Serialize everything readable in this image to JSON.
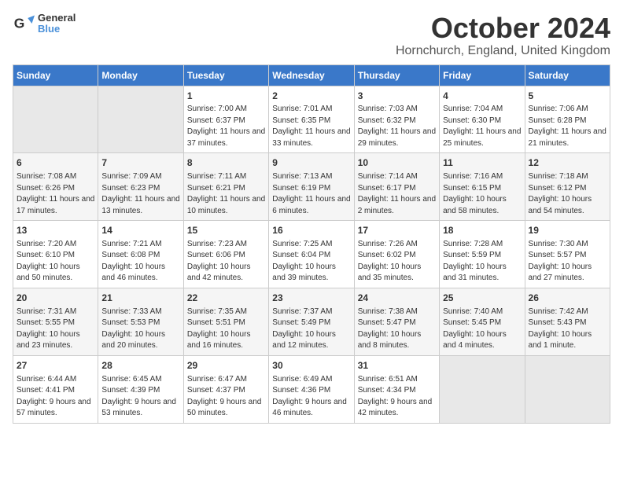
{
  "header": {
    "logo_line1": "General",
    "logo_line2": "Blue",
    "month": "October 2024",
    "location": "Hornchurch, England, United Kingdom"
  },
  "weekdays": [
    "Sunday",
    "Monday",
    "Tuesday",
    "Wednesday",
    "Thursday",
    "Friday",
    "Saturday"
  ],
  "weeks": [
    [
      {
        "day": "",
        "info": ""
      },
      {
        "day": "",
        "info": ""
      },
      {
        "day": "1",
        "info": "Sunrise: 7:00 AM\nSunset: 6:37 PM\nDaylight: 11 hours and 37 minutes."
      },
      {
        "day": "2",
        "info": "Sunrise: 7:01 AM\nSunset: 6:35 PM\nDaylight: 11 hours and 33 minutes."
      },
      {
        "day": "3",
        "info": "Sunrise: 7:03 AM\nSunset: 6:32 PM\nDaylight: 11 hours and 29 minutes."
      },
      {
        "day": "4",
        "info": "Sunrise: 7:04 AM\nSunset: 6:30 PM\nDaylight: 11 hours and 25 minutes."
      },
      {
        "day": "5",
        "info": "Sunrise: 7:06 AM\nSunset: 6:28 PM\nDaylight: 11 hours and 21 minutes."
      }
    ],
    [
      {
        "day": "6",
        "info": "Sunrise: 7:08 AM\nSunset: 6:26 PM\nDaylight: 11 hours and 17 minutes."
      },
      {
        "day": "7",
        "info": "Sunrise: 7:09 AM\nSunset: 6:23 PM\nDaylight: 11 hours and 13 minutes."
      },
      {
        "day": "8",
        "info": "Sunrise: 7:11 AM\nSunset: 6:21 PM\nDaylight: 11 hours and 10 minutes."
      },
      {
        "day": "9",
        "info": "Sunrise: 7:13 AM\nSunset: 6:19 PM\nDaylight: 11 hours and 6 minutes."
      },
      {
        "day": "10",
        "info": "Sunrise: 7:14 AM\nSunset: 6:17 PM\nDaylight: 11 hours and 2 minutes."
      },
      {
        "day": "11",
        "info": "Sunrise: 7:16 AM\nSunset: 6:15 PM\nDaylight: 10 hours and 58 minutes."
      },
      {
        "day": "12",
        "info": "Sunrise: 7:18 AM\nSunset: 6:12 PM\nDaylight: 10 hours and 54 minutes."
      }
    ],
    [
      {
        "day": "13",
        "info": "Sunrise: 7:20 AM\nSunset: 6:10 PM\nDaylight: 10 hours and 50 minutes."
      },
      {
        "day": "14",
        "info": "Sunrise: 7:21 AM\nSunset: 6:08 PM\nDaylight: 10 hours and 46 minutes."
      },
      {
        "day": "15",
        "info": "Sunrise: 7:23 AM\nSunset: 6:06 PM\nDaylight: 10 hours and 42 minutes."
      },
      {
        "day": "16",
        "info": "Sunrise: 7:25 AM\nSunset: 6:04 PM\nDaylight: 10 hours and 39 minutes."
      },
      {
        "day": "17",
        "info": "Sunrise: 7:26 AM\nSunset: 6:02 PM\nDaylight: 10 hours and 35 minutes."
      },
      {
        "day": "18",
        "info": "Sunrise: 7:28 AM\nSunset: 5:59 PM\nDaylight: 10 hours and 31 minutes."
      },
      {
        "day": "19",
        "info": "Sunrise: 7:30 AM\nSunset: 5:57 PM\nDaylight: 10 hours and 27 minutes."
      }
    ],
    [
      {
        "day": "20",
        "info": "Sunrise: 7:31 AM\nSunset: 5:55 PM\nDaylight: 10 hours and 23 minutes."
      },
      {
        "day": "21",
        "info": "Sunrise: 7:33 AM\nSunset: 5:53 PM\nDaylight: 10 hours and 20 minutes."
      },
      {
        "day": "22",
        "info": "Sunrise: 7:35 AM\nSunset: 5:51 PM\nDaylight: 10 hours and 16 minutes."
      },
      {
        "day": "23",
        "info": "Sunrise: 7:37 AM\nSunset: 5:49 PM\nDaylight: 10 hours and 12 minutes."
      },
      {
        "day": "24",
        "info": "Sunrise: 7:38 AM\nSunset: 5:47 PM\nDaylight: 10 hours and 8 minutes."
      },
      {
        "day": "25",
        "info": "Sunrise: 7:40 AM\nSunset: 5:45 PM\nDaylight: 10 hours and 4 minutes."
      },
      {
        "day": "26",
        "info": "Sunrise: 7:42 AM\nSunset: 5:43 PM\nDaylight: 10 hours and 1 minute."
      }
    ],
    [
      {
        "day": "27",
        "info": "Sunrise: 6:44 AM\nSunset: 4:41 PM\nDaylight: 9 hours and 57 minutes."
      },
      {
        "day": "28",
        "info": "Sunrise: 6:45 AM\nSunset: 4:39 PM\nDaylight: 9 hours and 53 minutes."
      },
      {
        "day": "29",
        "info": "Sunrise: 6:47 AM\nSunset: 4:37 PM\nDaylight: 9 hours and 50 minutes."
      },
      {
        "day": "30",
        "info": "Sunrise: 6:49 AM\nSunset: 4:36 PM\nDaylight: 9 hours and 46 minutes."
      },
      {
        "day": "31",
        "info": "Sunrise: 6:51 AM\nSunset: 4:34 PM\nDaylight: 9 hours and 42 minutes."
      },
      {
        "day": "",
        "info": ""
      },
      {
        "day": "",
        "info": ""
      }
    ]
  ]
}
